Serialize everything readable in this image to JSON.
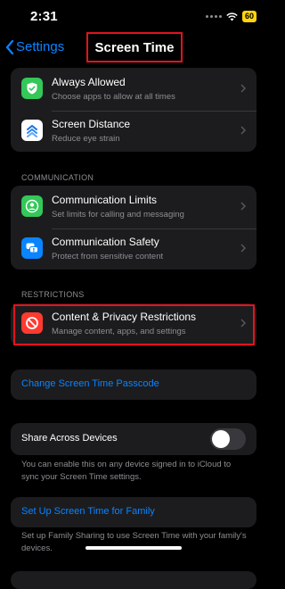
{
  "status_bar": {
    "time": "2:31",
    "battery": "60"
  },
  "nav": {
    "back_label": "Settings",
    "title": "Screen Time"
  },
  "group1": [
    {
      "title": "Always Allowed",
      "subtitle": "Choose apps to allow at all times",
      "icon": "checkmark-shield-icon",
      "icon_color": "#34c759"
    },
    {
      "title": "Screen Distance",
      "subtitle": "Reduce eye strain",
      "icon": "chevrons-up-icon",
      "icon_color": "#ffffff"
    }
  ],
  "communication": {
    "header": "COMMUNICATION",
    "items": [
      {
        "title": "Communication Limits",
        "subtitle": "Set limits for calling and messaging",
        "icon": "person-circle-icon",
        "icon_color": "#34c759"
      },
      {
        "title": "Communication Safety",
        "subtitle": "Protect from sensitive content",
        "icon": "chat-bubbles-icon",
        "icon_color": "#0a84ff"
      }
    ]
  },
  "restrictions": {
    "header": "RESTRICTIONS",
    "items": [
      {
        "title": "Content & Privacy Restrictions",
        "subtitle": "Manage content, apps, and settings",
        "icon": "no-entry-icon",
        "icon_color": "#ff3b30"
      }
    ]
  },
  "passcode": {
    "label": "Change Screen Time Passcode"
  },
  "share": {
    "label": "Share Across Devices",
    "toggle_on": false,
    "footnote": "You can enable this on any device signed in to iCloud to sync your Screen Time settings."
  },
  "family": {
    "label": "Set Up Screen Time for Family",
    "footnote": "Set up Family Sharing to use Screen Time with your family's devices."
  },
  "colors": {
    "accent": "#0a84ff",
    "highlight": "#e0141e"
  }
}
